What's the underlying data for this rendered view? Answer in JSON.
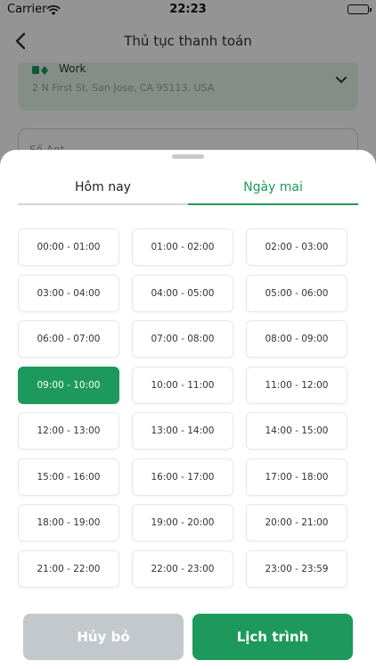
{
  "status_bar": {
    "carrier": "Carrier",
    "time": "22:23"
  },
  "header": {
    "title": "Thủ tục thanh toán"
  },
  "address": {
    "label": "Work",
    "line": "2 N First St, San Jose, CA 95113, USA"
  },
  "coupon": {
    "placeholder": "Số Ant"
  },
  "sheet": {
    "tabs": [
      {
        "label": "Hôm nay",
        "active": false
      },
      {
        "label": "Ngày mai",
        "active": true
      }
    ],
    "slots": [
      "00:00 - 01:00",
      "01:00 - 02:00",
      "02:00 - 03:00",
      "03:00 - 04:00",
      "04:00 - 05:00",
      "05:00 - 06:00",
      "06:00 - 07:00",
      "07:00 - 08:00",
      "08:00 - 09:00",
      "09:00 - 10:00",
      "10:00 - 11:00",
      "11:00 - 12:00",
      "12:00 - 13:00",
      "13:00 - 14:00",
      "14:00 - 15:00",
      "15:00 - 16:00",
      "16:00 - 17:00",
      "17:00 - 18:00",
      "18:00 - 19:00",
      "19:00 - 20:00",
      "20:00 - 21:00",
      "21:00 - 22:00",
      "22:00 - 23:00",
      "23:00 - 23:59"
    ],
    "selected_slot": "09:00 - 10:00",
    "cancel_label": "Hủy bỏ",
    "schedule_label": "Lịch trình"
  },
  "colors": {
    "accent": "#1d9a5b",
    "cancel": "#c3c8cc",
    "address_bg": "#e3f3e9"
  }
}
